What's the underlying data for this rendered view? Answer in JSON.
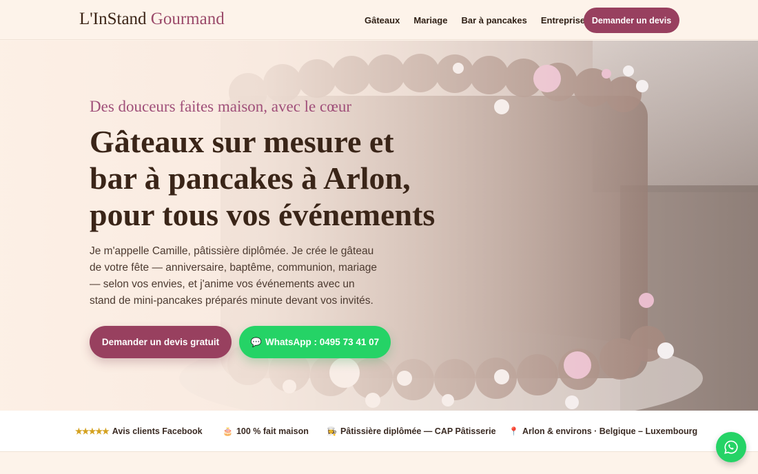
{
  "header": {
    "logo_main": "L'InStand ",
    "logo_accent": "Gourmand",
    "nav": [
      "Gâteaux",
      "Mariage",
      "Bar à pancakes",
      "Entreprises"
    ],
    "cta": "Demander un devis"
  },
  "hero": {
    "kicker": "Des douceurs faites maison, avec le cœur",
    "title_lines": [
      "Gâteaux sur mesure et",
      "bar à pancakes à Arlon,",
      "pour tous vos événements"
    ],
    "lead": "Je m'appelle Camille, pâtissière diplômée. Je crée le gâteau de votre fête — anniversaire, baptême, communion, mariage — selon vos envies, et j'anime vos événements avec un stand de mini-pancakes préparés minute devant vos invités.",
    "btn_primary": "Demander un devis gratuit",
    "btn_whatsapp_icon": "💬",
    "btn_whatsapp": "WhatsApp : 0495 73 41 07"
  },
  "trust": [
    {
      "icon": "★★★★★",
      "label": "Avis clients Facebook"
    },
    {
      "icon": "🎂",
      "label": "100 % fait maison"
    },
    {
      "icon": "👩‍🍳",
      "label": "Pâtissière diplômée — CAP Pâtisserie"
    },
    {
      "icon": "📍",
      "label": "Arlon & environs · Belgique – Luxembourg"
    }
  ],
  "colors": {
    "brand": "#98405f",
    "accent_text": "#a0507a",
    "whatsapp": "#25d366",
    "background": "#fdf3ea",
    "stars": "#d4a11e"
  },
  "icons": {
    "floating": "whatsapp-icon",
    "hero_image": "chocolate-cake-photo"
  }
}
